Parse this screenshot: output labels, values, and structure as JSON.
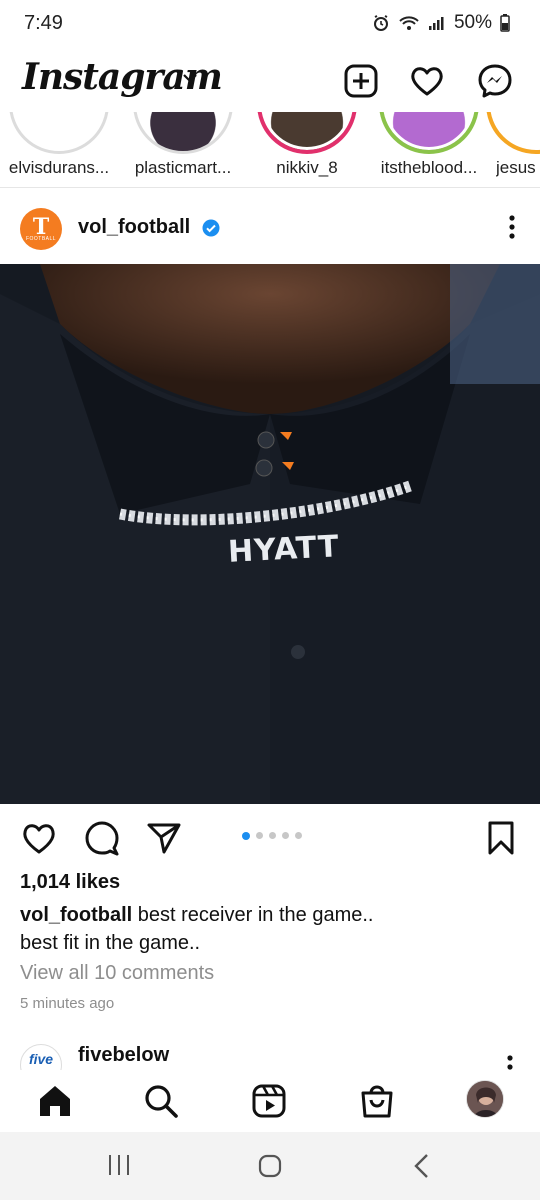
{
  "status_bar": {
    "time": "7:49",
    "battery": "50%"
  },
  "header": {
    "logo": "Instagram",
    "icons": [
      "chevron-down-icon",
      "add-post-icon",
      "heart-icon",
      "messenger-icon"
    ]
  },
  "stories": [
    {
      "label": "elvisdurans..."
    },
    {
      "label": "plasticmart..."
    },
    {
      "label": "nikkiv_8"
    },
    {
      "label": "itstheblood..."
    },
    {
      "label": "jesus"
    }
  ],
  "post": {
    "username": "vol_football",
    "avatar_text": "T",
    "avatar_sub": "FOOTBALL",
    "image_text": "HYATT",
    "carousel": {
      "total": 5,
      "active": 1
    },
    "likes": "1,014 likes",
    "caption_user": "vol_football",
    "caption_text": " best receiver in the game..",
    "caption_line2": "best fit in the game..",
    "view_comments": "View all 10 comments",
    "timestamp": "5 minutes ago"
  },
  "next_post": {
    "username": "fivebelow",
    "avatar_text": "five"
  },
  "bottom_nav": [
    "home-icon",
    "search-icon",
    "reels-icon",
    "shop-icon",
    "profile-avatar"
  ],
  "colors": {
    "accent_blue": "#1b8ef0",
    "vol_orange": "#f47c20",
    "muted_text": "#8e8e8e"
  }
}
